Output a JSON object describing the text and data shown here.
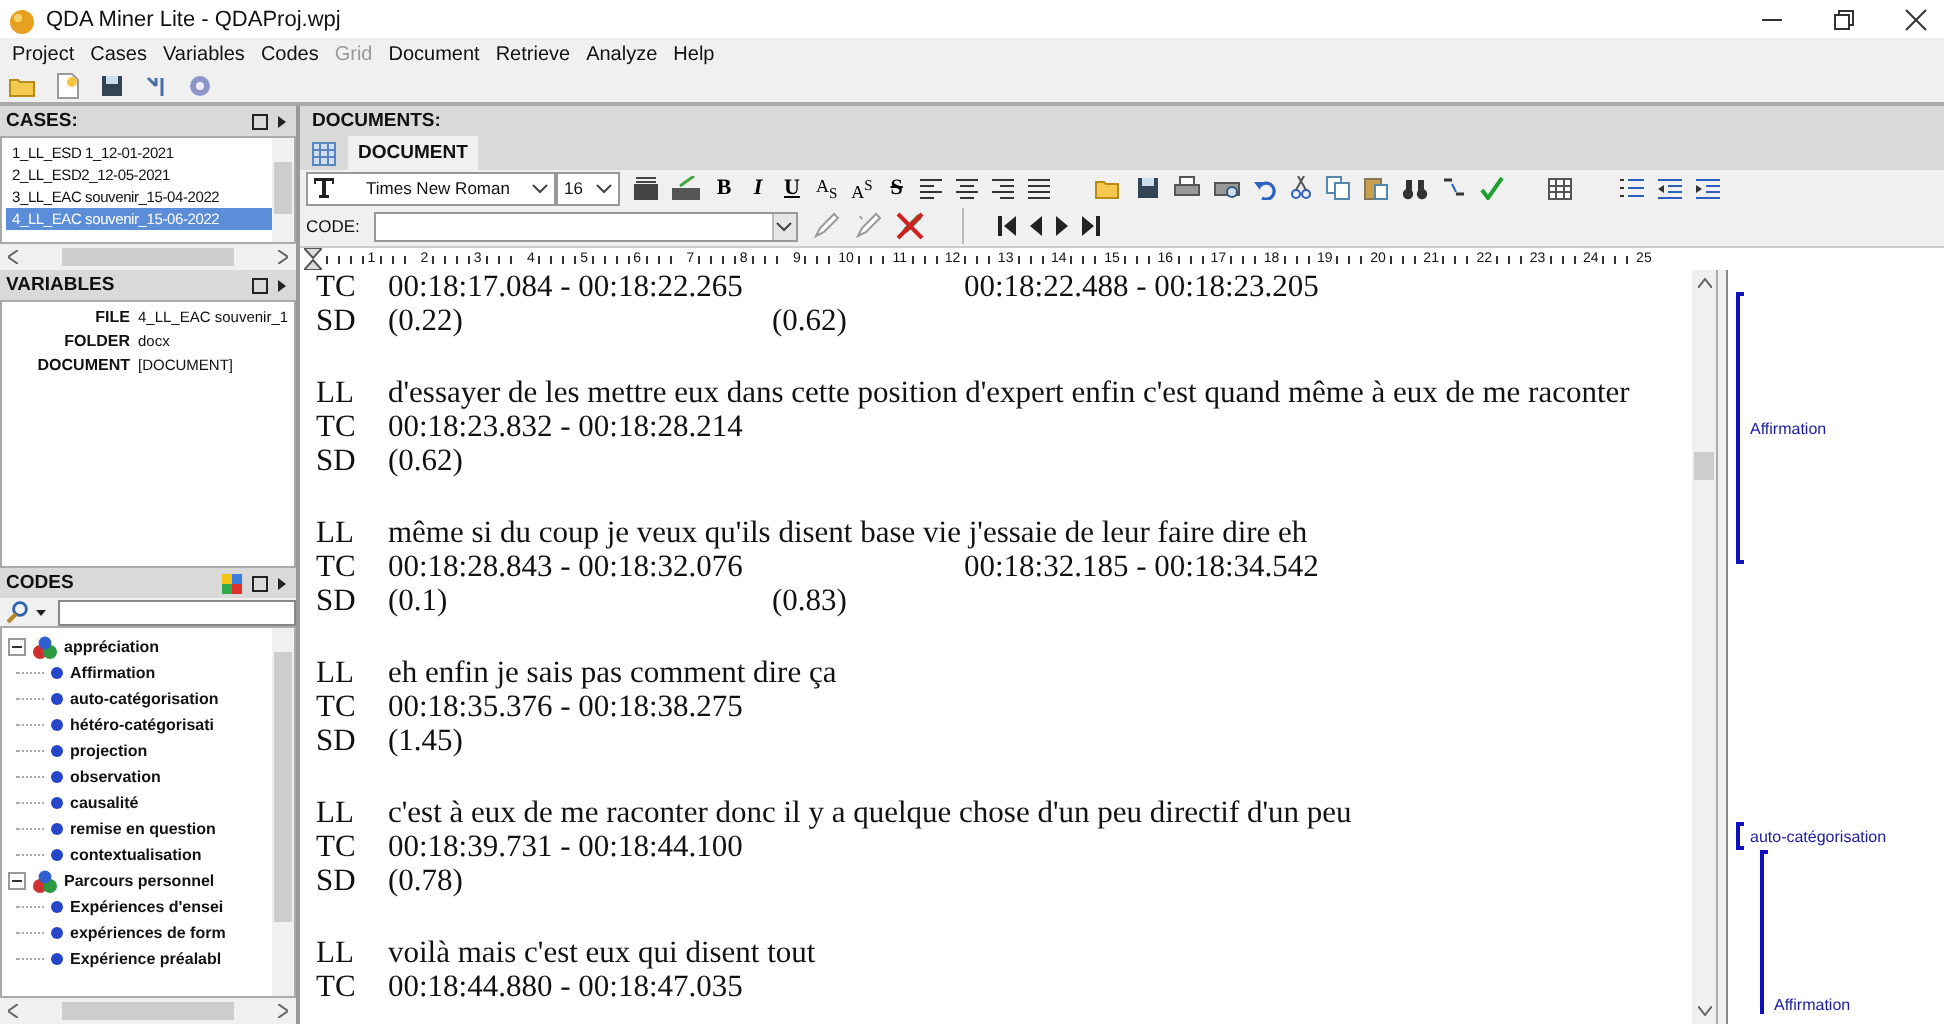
{
  "window": {
    "title": "QDA Miner Lite - QDAProj.wpj"
  },
  "menu": [
    {
      "label": "Project",
      "disabled": false
    },
    {
      "label": "Cases",
      "disabled": false
    },
    {
      "label": "Variables",
      "disabled": false
    },
    {
      "label": "Codes",
      "disabled": false
    },
    {
      "label": "Grid",
      "disabled": true
    },
    {
      "label": "Document",
      "disabled": false
    },
    {
      "label": "Retrieve",
      "disabled": false
    },
    {
      "label": "Analyze",
      "disabled": false
    },
    {
      "label": "Help",
      "disabled": false
    }
  ],
  "cases": {
    "title": "CASES:",
    "items": [
      {
        "label": "1_LL_ESD 1_12-01-2021",
        "selected": false
      },
      {
        "label": "2_LL_ESD2_12-05-2021",
        "selected": false
      },
      {
        "label": "3_LL_EAC souvenir_15-04-2022",
        "selected": false
      },
      {
        "label": "4_LL_EAC souvenir_15-06-2022",
        "selected": true
      }
    ]
  },
  "variables": {
    "title": "VARIABLES",
    "rows": [
      {
        "name": "FILE",
        "value": "4_LL_EAC souvenir_1"
      },
      {
        "name": "FOLDER",
        "value": "docx"
      },
      {
        "name": "DOCUMENT",
        "value": "[DOCUMENT]"
      }
    ]
  },
  "codes": {
    "title": "CODES",
    "tree": [
      {
        "label": "appréciation",
        "kind": "category",
        "expanded": true,
        "children": [
          {
            "label": "Affirmation",
            "kind": "code"
          },
          {
            "label": "auto-catégorisation",
            "kind": "code"
          },
          {
            "label": "hétéro-catégorisati",
            "kind": "code"
          },
          {
            "label": "projection",
            "kind": "code"
          },
          {
            "label": "observation",
            "kind": "code"
          },
          {
            "label": "causalité",
            "kind": "code"
          },
          {
            "label": "remise en question",
            "kind": "code"
          },
          {
            "label": "contextualisation",
            "kind": "code"
          }
        ]
      },
      {
        "label": "Parcours personnel",
        "kind": "category",
        "expanded": true,
        "children": [
          {
            "label": "Expériences d'ensei",
            "kind": "code"
          },
          {
            "label": "expériences de form",
            "kind": "code"
          },
          {
            "label": "Expérience préalabl",
            "kind": "code"
          }
        ]
      }
    ]
  },
  "documents": {
    "title": "DOCUMENTS:",
    "tabs": [
      {
        "label": "DOCUMENT",
        "selected": true
      }
    ],
    "font": "Times New Roman",
    "size": "16",
    "format_buttons": [
      {
        "label": "B",
        "kind": "bold"
      },
      {
        "label": "I",
        "kind": "italic"
      },
      {
        "label": "U",
        "kind": "underline"
      },
      {
        "label": "A$_{S}$",
        "kind": "plain"
      },
      {
        "label": "A$^{S}$",
        "kind": "plain"
      },
      {
        "label": "S",
        "kind": "strike"
      }
    ],
    "code_label": "CODE:",
    "ruler": [
      "1",
      "2",
      "3",
      "4",
      "5",
      "6",
      "7",
      "8",
      "9",
      "10",
      "11",
      "12",
      "13",
      "14",
      "15",
      "16",
      "17",
      "18",
      "19",
      "20",
      "21",
      "22",
      "23",
      "24",
      "25"
    ],
    "blocks": [
      [
        {
          "tag": "TC",
          "segments": [
            "00:18:17.084 - 00:18:22.265",
            "00:18:22.488 - 00:18:23.205"
          ]
        },
        {
          "tag": "SD",
          "segments": [
            "(0.22)",
            "(0.62)"
          ]
        }
      ],
      [
        {
          "tag": "LL",
          "segments": [
            "d'essayer de les mettre eux dans cette position d'expert enfin c'est quand même à eux de me raconter"
          ]
        },
        {
          "tag": "TC",
          "segments": [
            "00:18:23.832 - 00:18:28.214"
          ]
        },
        {
          "tag": "SD",
          "segments": [
            "(0.62)"
          ]
        }
      ],
      [
        {
          "tag": "LL",
          "segments": [
            "même si du coup je veux qu'ils disent base vie  j'essaie de leur faire dire eh"
          ]
        },
        {
          "tag": "TC",
          "segments": [
            "00:18:28.843 - 00:18:32.076",
            "00:18:32.185 - 00:18:34.542"
          ]
        },
        {
          "tag": "SD",
          "segments": [
            "(0.1)",
            "(0.83)"
          ]
        }
      ],
      [
        {
          "tag": "LL",
          "segments": [
            "eh enfin je sais pas comment dire ça"
          ]
        },
        {
          "tag": "TC",
          "segments": [
            "00:18:35.376 - 00:18:38.275"
          ]
        },
        {
          "tag": "SD",
          "segments": [
            "(1.45)"
          ]
        }
      ],
      [
        {
          "tag": "LL",
          "segments": [
            "c'est à eux de me raconter donc il y a quelque chose d'un peu directif d'un peu"
          ]
        },
        {
          "tag": "TC",
          "segments": [
            "00:18:39.731 - 00:18:44.100"
          ]
        },
        {
          "tag": "SD",
          "segments": [
            "(0.78)"
          ]
        }
      ],
      [
        {
          "tag": "LL",
          "segments": [
            "voilà mais c'est eux qui disent tout"
          ]
        },
        {
          "tag": "TC",
          "segments": [
            "00:18:44.880 - 00:18:47.035"
          ]
        }
      ]
    ],
    "margin_codes": [
      {
        "label": "Affirmation"
      },
      {
        "label": "auto-catégorisation"
      },
      {
        "label": "Affirmation"
      }
    ]
  }
}
